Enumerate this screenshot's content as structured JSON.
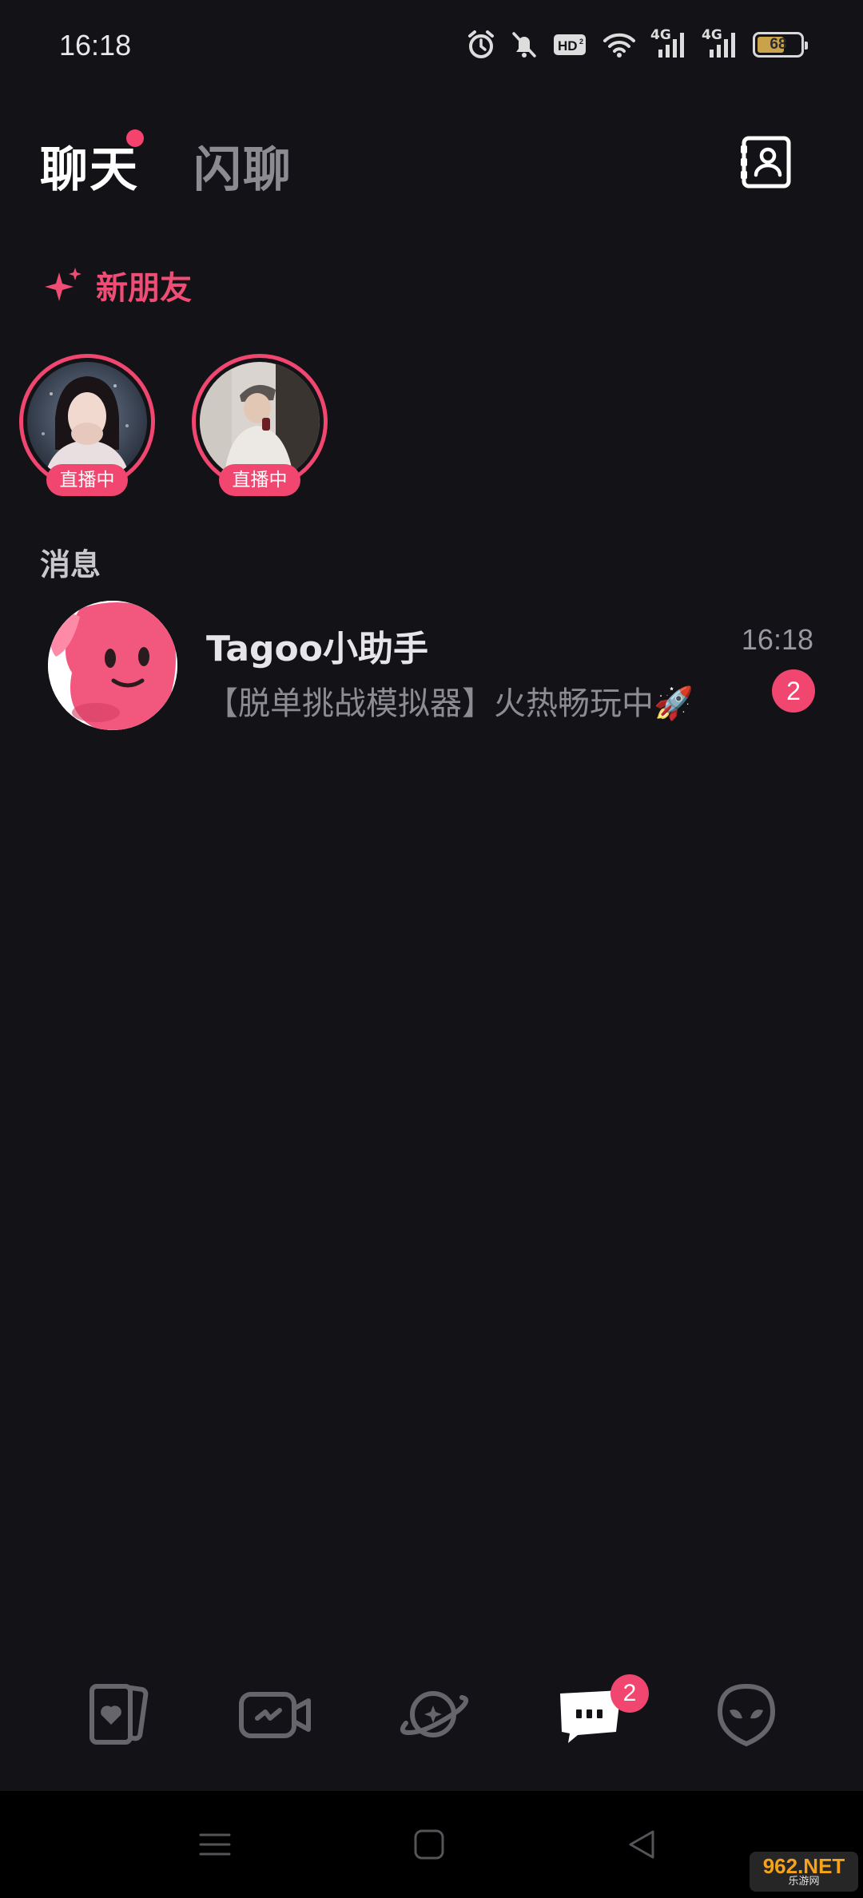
{
  "status_bar": {
    "time": "16:18",
    "hd_label": "HD",
    "network_1": "4G",
    "network_2": "4G",
    "battery_level": 68,
    "battery_text": "68",
    "icons": [
      "alarm-icon",
      "bell-off-icon",
      "hd-icon",
      "wifi-icon",
      "signal-4g-icon",
      "signal-4g-icon",
      "battery-icon"
    ]
  },
  "header": {
    "tabs": [
      {
        "label": "聊天",
        "active": true,
        "has_dot": true
      },
      {
        "label": "闪聊",
        "active": false
      }
    ],
    "contacts_icon": "contacts-icon"
  },
  "new_friends": {
    "title": "新朋友",
    "icon": "sparkle-icon",
    "live_users": [
      {
        "badge": "直播中"
      },
      {
        "badge": "直播中"
      }
    ]
  },
  "messages": {
    "title": "消息",
    "items": [
      {
        "name": "Tagoo小助手",
        "preview": "【脱单挑战模拟器】火热畅玩中🚀",
        "time": "16:18",
        "unread": "2"
      }
    ]
  },
  "tabbar": {
    "items": [
      {
        "icon": "cards-heart-icon"
      },
      {
        "icon": "video-call-icon"
      },
      {
        "icon": "planet-icon"
      },
      {
        "icon": "chat-icon",
        "active": true,
        "badge": "2"
      },
      {
        "icon": "alien-icon"
      }
    ]
  },
  "system_nav": {
    "buttons": [
      "menu-icon",
      "home-icon",
      "back-icon"
    ]
  },
  "watermark": {
    "main": "962.NET",
    "sub": "乐游网"
  },
  "colors": {
    "background": "#131217",
    "accent": "#f0466f",
    "text_primary": "#ffffff",
    "text_secondary": "#8d8c92"
  }
}
